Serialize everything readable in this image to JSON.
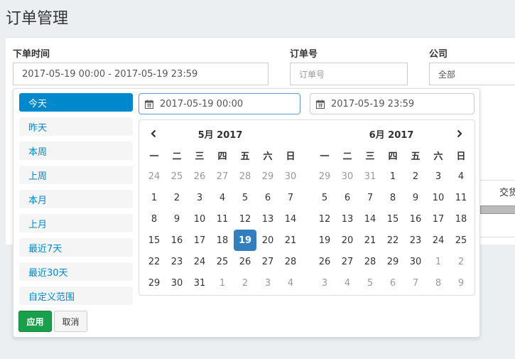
{
  "page": {
    "title": "订单管理"
  },
  "filters": {
    "order_time": {
      "label": "下单时间",
      "value": "2017-05-19 00:00 - 2017-05-19 23:59"
    },
    "order_no": {
      "label": "订单号",
      "placeholder": "订单号"
    },
    "company": {
      "label": "公司",
      "value": "全部"
    }
  },
  "table": {
    "partial_header": "交货"
  },
  "ranges": [
    {
      "label": "今天",
      "active": true
    },
    {
      "label": "昨天",
      "active": false
    },
    {
      "label": "本周",
      "active": false
    },
    {
      "label": "上周",
      "active": false
    },
    {
      "label": "本月",
      "active": false
    },
    {
      "label": "上月",
      "active": false
    },
    {
      "label": "最近7天",
      "active": false
    },
    {
      "label": "最近30天",
      "active": false
    },
    {
      "label": "自定义范围",
      "active": false
    }
  ],
  "buttons": {
    "apply": "应用",
    "cancel": "取消"
  },
  "start_input": "2017-05-19 00:00",
  "end_input": "2017-05-19 23:59",
  "weekdays": [
    "一",
    "二",
    "三",
    "四",
    "五",
    "六",
    "日"
  ],
  "calendars": [
    {
      "title": "5月 2017",
      "weeks": [
        [
          "24",
          "25",
          "26",
          "27",
          "28",
          "29",
          "30"
        ],
        [
          "1",
          "2",
          "3",
          "4",
          "5",
          "6",
          "7"
        ],
        [
          "8",
          "9",
          "10",
          "11",
          "12",
          "13",
          "14"
        ],
        [
          "15",
          "16",
          "17",
          "18",
          "19",
          "20",
          "21"
        ],
        [
          "22",
          "23",
          "24",
          "25",
          "26",
          "27",
          "28"
        ],
        [
          "29",
          "30",
          "31",
          "1",
          "2",
          "3",
          "4"
        ]
      ],
      "off": [
        [
          0,
          0
        ],
        [
          0,
          1
        ],
        [
          0,
          2
        ],
        [
          0,
          3
        ],
        [
          0,
          4
        ],
        [
          0,
          5
        ],
        [
          0,
          6
        ],
        [
          5,
          3
        ],
        [
          5,
          4
        ],
        [
          5,
          5
        ],
        [
          5,
          6
        ]
      ],
      "selected": [
        3,
        4
      ]
    },
    {
      "title": "6月 2017",
      "weeks": [
        [
          "29",
          "30",
          "31",
          "1",
          "2",
          "3",
          "4"
        ],
        [
          "5",
          "6",
          "7",
          "8",
          "9",
          "10",
          "11"
        ],
        [
          "12",
          "13",
          "14",
          "15",
          "16",
          "17",
          "18"
        ],
        [
          "19",
          "20",
          "21",
          "22",
          "23",
          "24",
          "25"
        ],
        [
          "26",
          "27",
          "28",
          "29",
          "30",
          "1",
          "2"
        ],
        [
          "3",
          "4",
          "5",
          "6",
          "7",
          "8",
          "9"
        ]
      ],
      "off": [
        [
          0,
          0
        ],
        [
          0,
          1
        ],
        [
          0,
          2
        ],
        [
          4,
          5
        ],
        [
          4,
          6
        ],
        [
          5,
          0
        ],
        [
          5,
          1
        ],
        [
          5,
          2
        ],
        [
          5,
          3
        ],
        [
          5,
          4
        ],
        [
          5,
          5
        ],
        [
          5,
          6
        ]
      ],
      "selected": null
    }
  ],
  "colors": {
    "accent": "#0088cc",
    "selected_day": "#357ebd",
    "apply_button": "#1a9f4c"
  },
  "icons": {
    "calendar": "calendar-icon",
    "prev": "chevron-left-icon",
    "next": "chevron-right-icon"
  }
}
